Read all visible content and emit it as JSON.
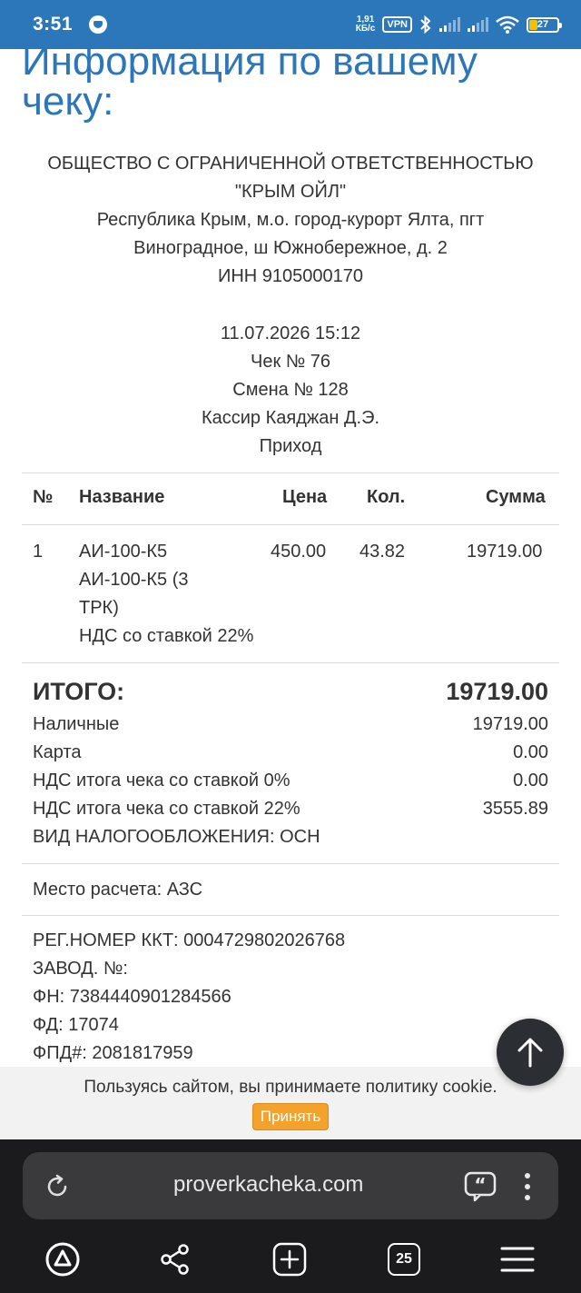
{
  "status_bar": {
    "time": "3:51",
    "net_speed_value": "1,91",
    "net_speed_unit": "КБ/с",
    "vpn": "VPN",
    "battery": "27"
  },
  "page": {
    "title_line1": "Информация по вашему",
    "title_line2": "чеку:"
  },
  "company": {
    "name_line1": "ОБЩЕСТВО С ОГРАНИЧЕННОЙ ОТВЕТСТВЕННОСТЬЮ",
    "name_line2": "\"КРЫМ ОЙЛ\"",
    "address_line1": "Республика Крым, м.о. город-курорт Ялта, пгт",
    "address_line2": "Виноградное, ш Южнобережное, д. 2",
    "inn": "ИНН 9105000170"
  },
  "receipt": {
    "datetime": "11.07.2026 15:12",
    "check_no": "Чек № 76",
    "shift": "Смена № 128",
    "cashier": "Кассир Каяджан Д.Э.",
    "operation": "Приход"
  },
  "table": {
    "headers": {
      "no": "№",
      "name": "Название",
      "price": "Цена",
      "qty": "Кол.",
      "sum": "Сумма"
    },
    "rows": [
      {
        "no": "1",
        "name_line1": "АИ-100-К5",
        "name_line2": "АИ-100-К5 (3",
        "name_line3": "ТРК)",
        "vat": "НДС со ставкой 22%",
        "price": "450.00",
        "qty": "43.82",
        "sum": "19719.00"
      }
    ]
  },
  "totals": {
    "total_label": "ИТОГО:",
    "total_value": "19719.00",
    "cash_label": "Наличные",
    "cash_value": "19719.00",
    "card_label": "Карта",
    "card_value": "0.00",
    "vat0_label": "НДС итога чека со ставкой 0%",
    "vat0_value": "0.00",
    "vat22_label": "НДС итога чека со ставкой 22%",
    "vat22_value": "3555.89",
    "tax_system": "ВИД НАЛОГООБЛОЖЕНИЯ: ОСН"
  },
  "place": "Место расчета: АЗС",
  "registration": {
    "kkt_reg": "РЕГ.НОМЕР ККТ: 0004729802026768",
    "factory_no": "ЗАВОД. №:",
    "fn": "ФН: 7384440901284566",
    "fd": "ФД: 17074",
    "fpd": "ФПД#: 2081817959"
  },
  "cookie": {
    "text": "Пользуясь сайтом, вы принимаете политику cookie.",
    "accept": "Принять"
  },
  "browser": {
    "url": "proverkacheka.com",
    "tabs_count": "25"
  },
  "colors": {
    "accent": "#2b77b9",
    "cookie_button": "#f3a22c",
    "browser_bg": "#1b1b1d"
  }
}
